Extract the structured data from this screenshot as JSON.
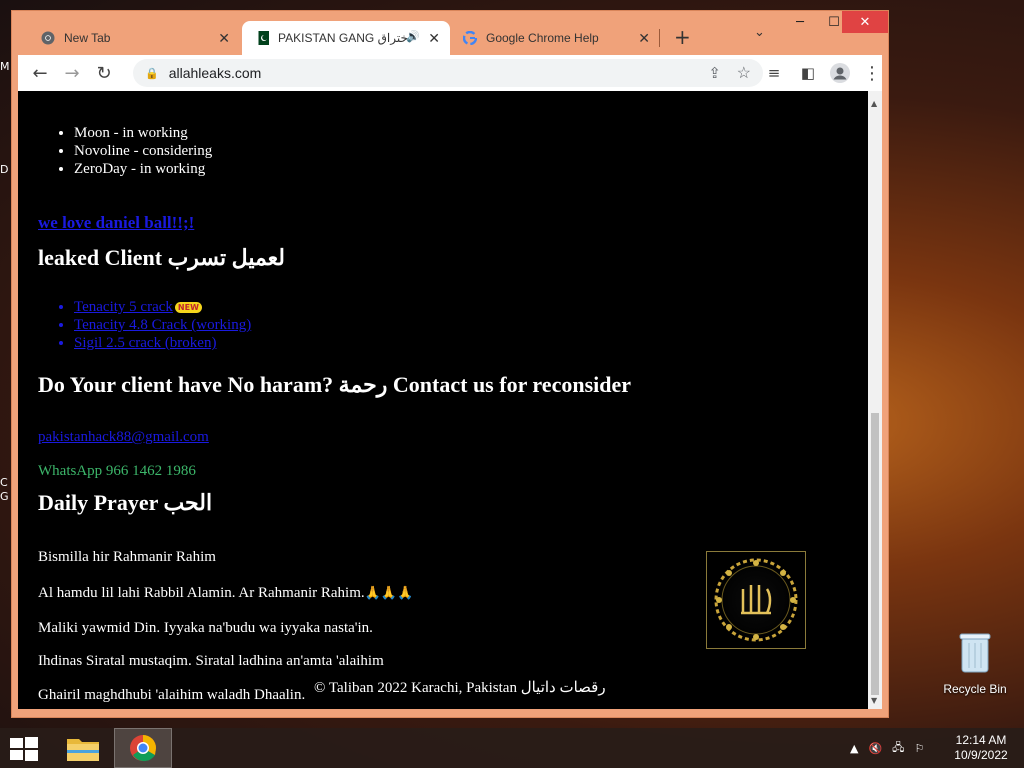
{
  "desktop": {
    "fragments": [
      "M",
      "D",
      "C",
      "G"
    ],
    "recycle_bin_label": "Recycle Bin"
  },
  "browser": {
    "tabs": [
      {
        "title": "New Tab"
      },
      {
        "title": "PAKISTAN GANG اختراق"
      },
      {
        "title": "Google Chrome Help"
      }
    ],
    "url": "allahleaks.com"
  },
  "page": {
    "wip_list": [
      "Moon - in working",
      "Novoline - considering",
      "ZeroDay - in working"
    ],
    "love_link": "we love daniel ball!!;!",
    "leaked_heading": "leaked Client لعميل تسرب",
    "leaked_list": [
      "Tenacity 5 crack",
      "Tenacity 4.8 Crack (working)",
      "Sigil 2.5 crack (broken)"
    ],
    "new_badge": "NEW",
    "haram_heading": "Do Your client have No haram? رحمة Contact us for reconsider",
    "email": "pakistanhack88@gmail.com",
    "whatsapp": "WhatsApp 966 1462 1986",
    "prayer_heading": "Daily Prayer الحب",
    "prayer_lines": [
      "Bismilla hir Rahmanir Rahim",
      "Al hamdu lil lahi Rabbil Alamin. Ar Rahmanir Rahim.",
      "Maliki yawmid Din. Iyyaka na'budu wa iyyaka nasta'in.",
      "Ihdinas Siratal mustaqim. Siratal ladhina an'amta 'alaihim",
      "Ghairil maghdhubi 'alaihim waladh Dhaalin."
    ],
    "footer": "© Taliban 2022 Karachi, Pakistan رقصات داتيال"
  },
  "taskbar": {
    "time": "12:14 AM",
    "date": "10/9/2022"
  },
  "colors": {
    "link": "#1a1ae0",
    "whatsapp": "#3cb66a",
    "window_frame": "#f0a27a"
  }
}
